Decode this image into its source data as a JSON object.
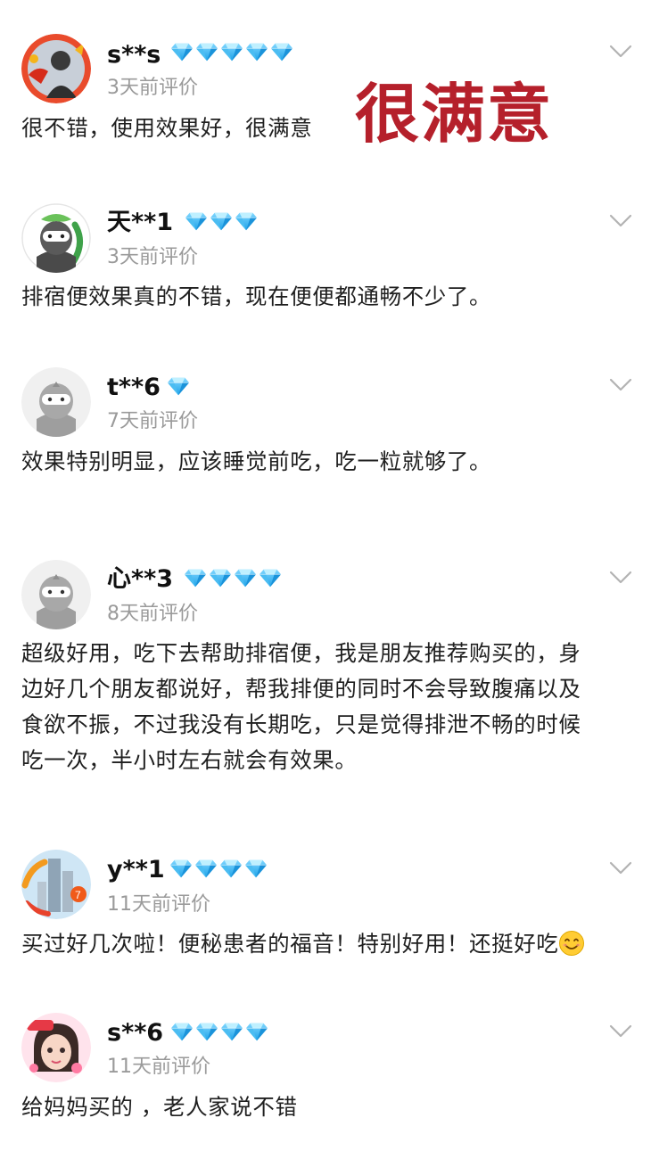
{
  "colors": {
    "diamond": "#3fb7f0",
    "date": "#9a9a9a",
    "stamp": "#b5202b"
  },
  "stamp_text": "很满意",
  "reviews": [
    {
      "username": "s**s",
      "diamond_count": 5,
      "date": "3天前评价",
      "content": "很不错，使用效果好，很满意",
      "avatar_icon": "red-costume-avatar-icon"
    },
    {
      "username": "天**1",
      "diamond_count": 3,
      "date": "3天前评价",
      "content": "排宿便效果真的不错，现在便便都通畅不少了。",
      "avatar_icon": "green-ninja-avatar-icon"
    },
    {
      "username": "t**6",
      "diamond_count": 1,
      "date": "7天前评价",
      "content": "效果特别明显，应该睡觉前吃，吃一粒就够了。",
      "avatar_icon": "default-ninja-avatar-icon"
    },
    {
      "username": "心**3",
      "diamond_count": 4,
      "date": "8天前评价",
      "content_lines": [
        "超级好用，吃下去帮助排宿便，我是朋友推荐购买的，身",
        "边好几个朋友都说好，帮我排便的同时不会导致腹痛以及",
        "食欲不振，不过我没有长期吃，只是觉得排泄不畅的时候",
        "吃一次，半小时左右就会有效果。"
      ],
      "avatar_icon": "default-ninja-avatar-icon"
    },
    {
      "username": "y**1",
      "diamond_count": 4,
      "date": "11天前评价",
      "content": "买过好几次啦！便秘患者的福音！特别好用！还挺好吃",
      "emoji": "smiling-face-emoji",
      "avatar_icon": "city-building-avatar-icon"
    },
    {
      "username": "s**6",
      "diamond_count": 4,
      "date": "11天前评价",
      "content": "给妈妈买的 ，老人家说不错",
      "avatar_icon": "doll-girl-avatar-icon"
    }
  ]
}
